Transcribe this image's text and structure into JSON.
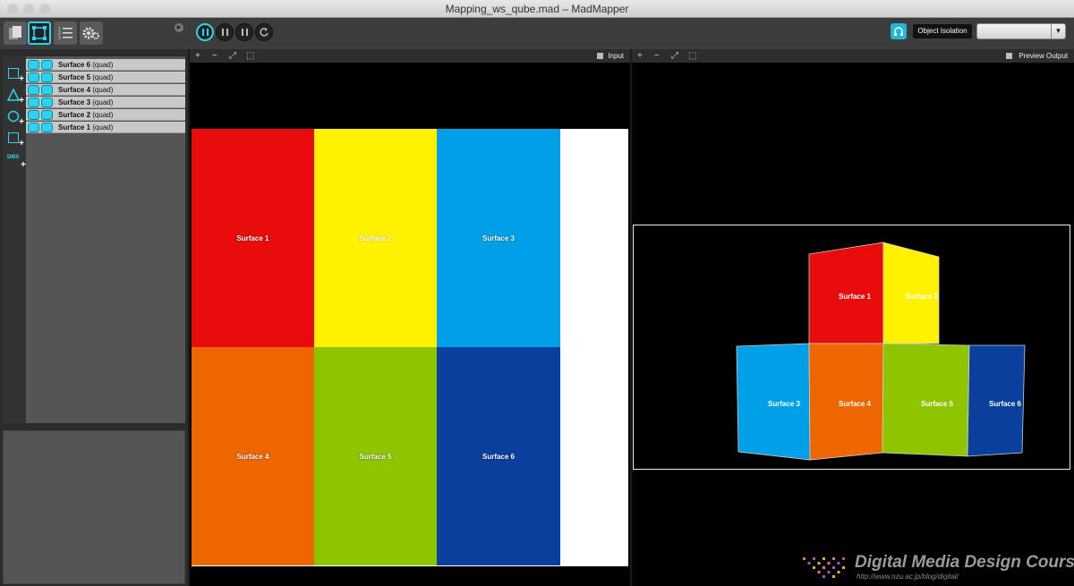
{
  "window": {
    "title": "Mapping_ws_qube.mad – MadMapper"
  },
  "toolbar": {
    "object_isolation_label": "Object Isolation",
    "isolation_select_value": ""
  },
  "layers": {
    "items": [
      {
        "name": "Surface 6",
        "kind": "(quad)"
      },
      {
        "name": "Surface 5",
        "kind": "(quad)"
      },
      {
        "name": "Surface 4",
        "kind": "(quad)"
      },
      {
        "name": "Surface 3",
        "kind": "(quad)"
      },
      {
        "name": "Surface 2",
        "kind": "(quad)"
      },
      {
        "name": "Surface 1",
        "kind": "(quad)"
      }
    ]
  },
  "tools": {
    "dmx_label": "DMX"
  },
  "input_view": {
    "label": "Input",
    "surfaces": [
      {
        "label": "Surface 1",
        "color": "#e80c0c"
      },
      {
        "label": "Surface 2",
        "color": "#fff200"
      },
      {
        "label": "Surface 3",
        "color": "#00a0e8"
      },
      {
        "label": "Surface 4",
        "color": "#ee6600"
      },
      {
        "label": "Surface 5",
        "color": "#8fc400"
      },
      {
        "label": "Surface 6",
        "color": "#0a3f9e"
      }
    ]
  },
  "output_view": {
    "label": "Preview Output",
    "surfaces": [
      {
        "label": "Surface 1"
      },
      {
        "label": "Surface 2"
      },
      {
        "label": "Surface 3"
      },
      {
        "label": "Surface 4"
      },
      {
        "label": "Surface 5"
      },
      {
        "label": "Surface 6"
      }
    ]
  },
  "zoom_controls": {
    "plus": "+",
    "minus": "−"
  },
  "watermark": {
    "title": "Digital Media Design Course",
    "url": "http://www.nzu.ac.jp/blog/digital/"
  },
  "colors": {
    "accent": "#2ad4f0"
  }
}
